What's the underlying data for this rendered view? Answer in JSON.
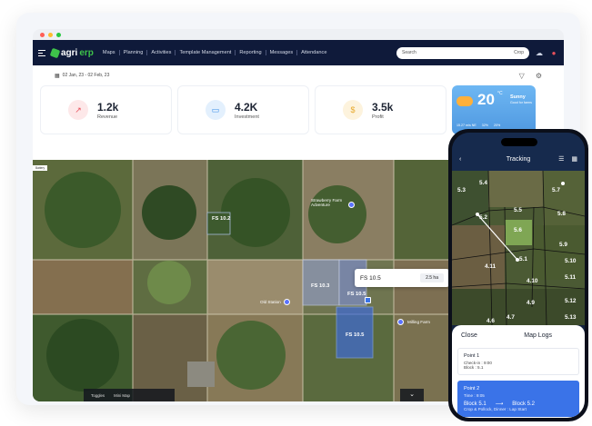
{
  "window": {
    "dots": [
      "close",
      "minimize",
      "maximize"
    ]
  },
  "brand": {
    "prefix": "agri",
    "suffix": "erp"
  },
  "nav": {
    "items": [
      "Maps",
      "Planning",
      "Activities",
      "Template Management",
      "Reporting",
      "Messages",
      "Attendance"
    ],
    "search_placeholder": "Search",
    "search_filter": "Crop"
  },
  "toolbar": {
    "date_range": "02 Jan, 23 - 02 Feb, 23"
  },
  "stats": [
    {
      "value": "1.2k",
      "label": "Revenue",
      "icon": "chart-trend-icon",
      "color": "#e8505b",
      "bg": "#fde8e9"
    },
    {
      "value": "4.2K",
      "label": "Investment",
      "icon": "wallet-icon",
      "color": "#3a8ee8",
      "bg": "#e3f0fd"
    },
    {
      "value": "3.5k",
      "label": "Profit",
      "icon": "dollar-icon",
      "color": "#e7a92b",
      "bg": "#fdf3dd"
    }
  ],
  "weather": {
    "temp": "20",
    "unit": "°C",
    "status": "Sunny",
    "sub": "Good for farms",
    "wind": "15.27 m/s NE",
    "humidity": "32%",
    "rain": "20%"
  },
  "map": {
    "attribution": "Battery",
    "fields": [
      "FS 10.2",
      "FS 10.3",
      "FS 10.5",
      "FS 10.5"
    ],
    "places": [
      "Strawberry Farm Adventure",
      "Old Station",
      "Milling Farm"
    ],
    "popup": {
      "name": "FS 10.5",
      "area": "2.5 ha"
    },
    "toggles_label": "Toggles",
    "toggles_option": "Mini Map"
  },
  "phone": {
    "title": "Tracking",
    "blocks": [
      "5.3",
      "5.4",
      "5.7",
      "5.2",
      "5.5",
      "5.8",
      "5.6",
      "5.9",
      "4.11",
      "5.1",
      "4.10",
      "5.10",
      "4.9",
      "5.11",
      "5.12",
      "4.7",
      "4.6",
      "5.13"
    ],
    "sheet": {
      "close": "Close",
      "title": "Map Logs",
      "logs": [
        {
          "point": "Point 1",
          "line1": "Check-in : 9:00",
          "line2": "Block : 5.1"
        },
        {
          "point": "Point 2",
          "line1": "Time : 9:05",
          "from": "Block 5.1",
          "to": "Block 5.2",
          "line2": "Crop & Pollock, Dinner : Lap Start"
        }
      ]
    }
  },
  "colors": {
    "nav_bg": "#0f1a3a",
    "accent": "#3a73e8",
    "brand_green": "#3ec24a"
  }
}
